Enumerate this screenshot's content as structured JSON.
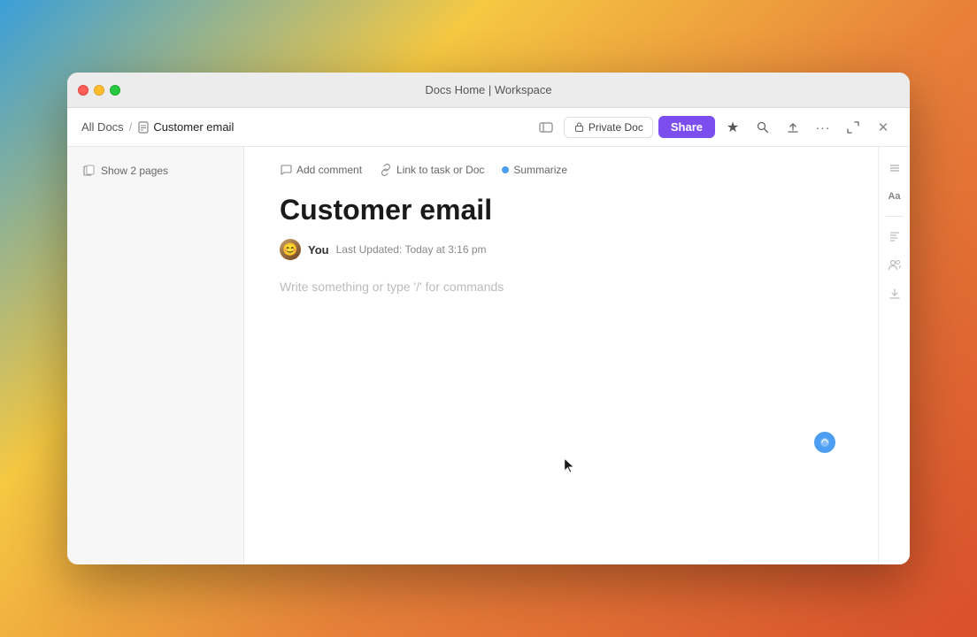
{
  "window": {
    "title": "Docs Home | Workspace"
  },
  "titlebar": {
    "title": "Docs Home | Workspace"
  },
  "toolbar": {
    "breadcrumb": {
      "all_docs_label": "All Docs",
      "separator": "/",
      "current_doc_label": "Customer email"
    },
    "private_doc_label": "Private Doc",
    "share_label": "Share"
  },
  "sidebar": {
    "show_pages_label": "Show 2 pages"
  },
  "doc_actions": {
    "add_comment_label": "Add comment",
    "link_to_task_label": "Link to task or Doc",
    "summarize_label": "Summarize"
  },
  "doc": {
    "title": "Customer email",
    "author": "You",
    "last_updated_prefix": "Last Updated:",
    "last_updated_time": "Today at 3:16 pm",
    "placeholder": "Write something or type '/' for commands"
  },
  "icons": {
    "close": "×",
    "minimize": "—",
    "maximize": "+",
    "doc": "📄",
    "comment": "💬",
    "link": "🔗",
    "star": "★",
    "search": "🔍",
    "export": "↑",
    "more": "···",
    "collapse": "⊡",
    "lock": "🔒",
    "font": "Aa",
    "toc": "≡",
    "users": "👥",
    "download": "↓",
    "full_screen": "⤢",
    "close_window": "✕"
  },
  "colors": {
    "share_btn_bg": "#7c4ef0",
    "share_btn_text": "#ffffff",
    "summarize_dot": "#4d9ef5",
    "title_text": "#1a1a1a"
  }
}
